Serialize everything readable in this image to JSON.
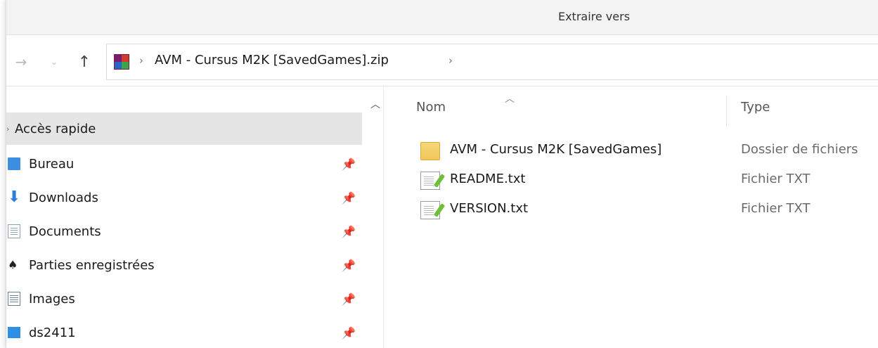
{
  "window": {
    "title": "Extraire vers"
  },
  "navigation": {
    "back_icon": "arrow-right-icon",
    "recent_icon": "chevron-down-icon",
    "up_icon": "arrow-up-icon"
  },
  "address": {
    "archive_icon": "winrar-archive-icon",
    "path": "AVM - Cursus M2K [SavedGames].zip"
  },
  "sidebar": {
    "section_label": "Accès rapide",
    "items": [
      {
        "label": "Bureau",
        "icon": "desktop-icon"
      },
      {
        "label": "Downloads",
        "icon": "download-icon"
      },
      {
        "label": "Documents",
        "icon": "document-icon"
      },
      {
        "label": "Parties enregistrées",
        "icon": "saved-games-icon"
      },
      {
        "label": "Images",
        "icon": "images-icon"
      },
      {
        "label": "ds2411",
        "icon": "computer-icon"
      }
    ]
  },
  "file_list": {
    "columns": {
      "name": "Nom",
      "type": "Type"
    },
    "sort_column": "Nom",
    "rows": [
      {
        "name": "AVM - Cursus M2K [SavedGames]",
        "type": "Dossier de fichiers",
        "icon": "folder-icon"
      },
      {
        "name": "README.txt",
        "type": "Fichier TXT",
        "icon": "text-file-icon"
      },
      {
        "name": "VERSION.txt",
        "type": "Fichier TXT",
        "icon": "text-file-icon"
      }
    ]
  },
  "colors": {
    "titlebar": "#f3f3f3",
    "selected_item": "#e5e5e5",
    "folder": "#f2c65a"
  }
}
